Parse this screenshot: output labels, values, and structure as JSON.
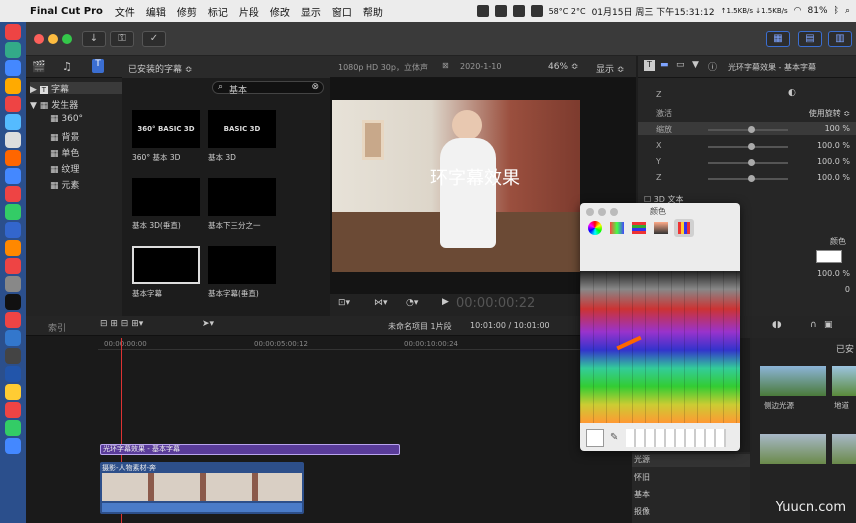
{
  "menubar": {
    "apple": "",
    "app": "Final Cut Pro",
    "menus": [
      "文件",
      "编辑",
      "修剪",
      "标记",
      "片段",
      "修改",
      "显示",
      "窗口",
      "帮助"
    ],
    "net": "↑1.5KB/s ↓1.5KB/s",
    "temp": "58°C 2°C",
    "date": "01月15日 周三 下午15:31:12",
    "battery": "81%"
  },
  "colors": {
    "accent": "#7b52c6",
    "blue": "#3b6ed1"
  },
  "sidebar": {
    "root": "字幕",
    "gen": "发生器",
    "items": [
      "360°",
      "背景",
      "单色",
      "纹理",
      "元素"
    ]
  },
  "browser": {
    "header": "已安装的字幕 ≎",
    "search": "基本",
    "items": [
      {
        "label": "360° 基本 3D",
        "thumb": "360° BASIC 3D"
      },
      {
        "label": "基本 3D",
        "thumb": "BASIC 3D"
      },
      {
        "label": "基本 3D(垂直)",
        "thumb": ""
      },
      {
        "label": "基本下三分之一",
        "thumb": ""
      },
      {
        "label": "基本字幕",
        "thumb": ""
      },
      {
        "label": "基本字幕(垂直)",
        "thumb": ""
      }
    ]
  },
  "viewer": {
    "format": "1080p HD 30p，立体声",
    "date": "2020-1-10",
    "zoom": "46% ≎",
    "view": "显示 ≎",
    "overlay": "环字幕效果",
    "timecode": "00:00:00:22"
  },
  "inspector": {
    "title": "光环字幕效果 - 基本字幕",
    "rows": [
      {
        "k": "Z",
        "v": ""
      },
      {
        "k": "激活",
        "v": "使用旋转 ≎"
      },
      {
        "k": "缩放",
        "v": "100 %"
      },
      {
        "k": "X",
        "v": "100.0 %"
      },
      {
        "k": "Y",
        "v": "100.0 %"
      },
      {
        "k": "Z",
        "v": "100.0 %"
      }
    ],
    "text3d": "3D 文本",
    "color": "颜色",
    "pct": "100.0 %",
    "zero": "0"
  },
  "colorpanel": {
    "title": "颜色"
  },
  "timeline": {
    "index": "索引",
    "project": "未命名项目 1片段",
    "dur": "10:01:00 / 10:01:00",
    "ruler": [
      "00:00:00:00",
      "00:00:05:00:12",
      "00:00:10:00:24"
    ],
    "title_clip": "光环字幕效果 - 基本字幕",
    "video_clip": "摄影-人物素材-奔"
  },
  "effects": {
    "header": "已安",
    "items": [
      "侧边光源",
      "地道"
    ],
    "list": [
      "光源",
      "怀旧",
      "基本",
      "报像"
    ]
  },
  "watermark": "Yuucn.com"
}
